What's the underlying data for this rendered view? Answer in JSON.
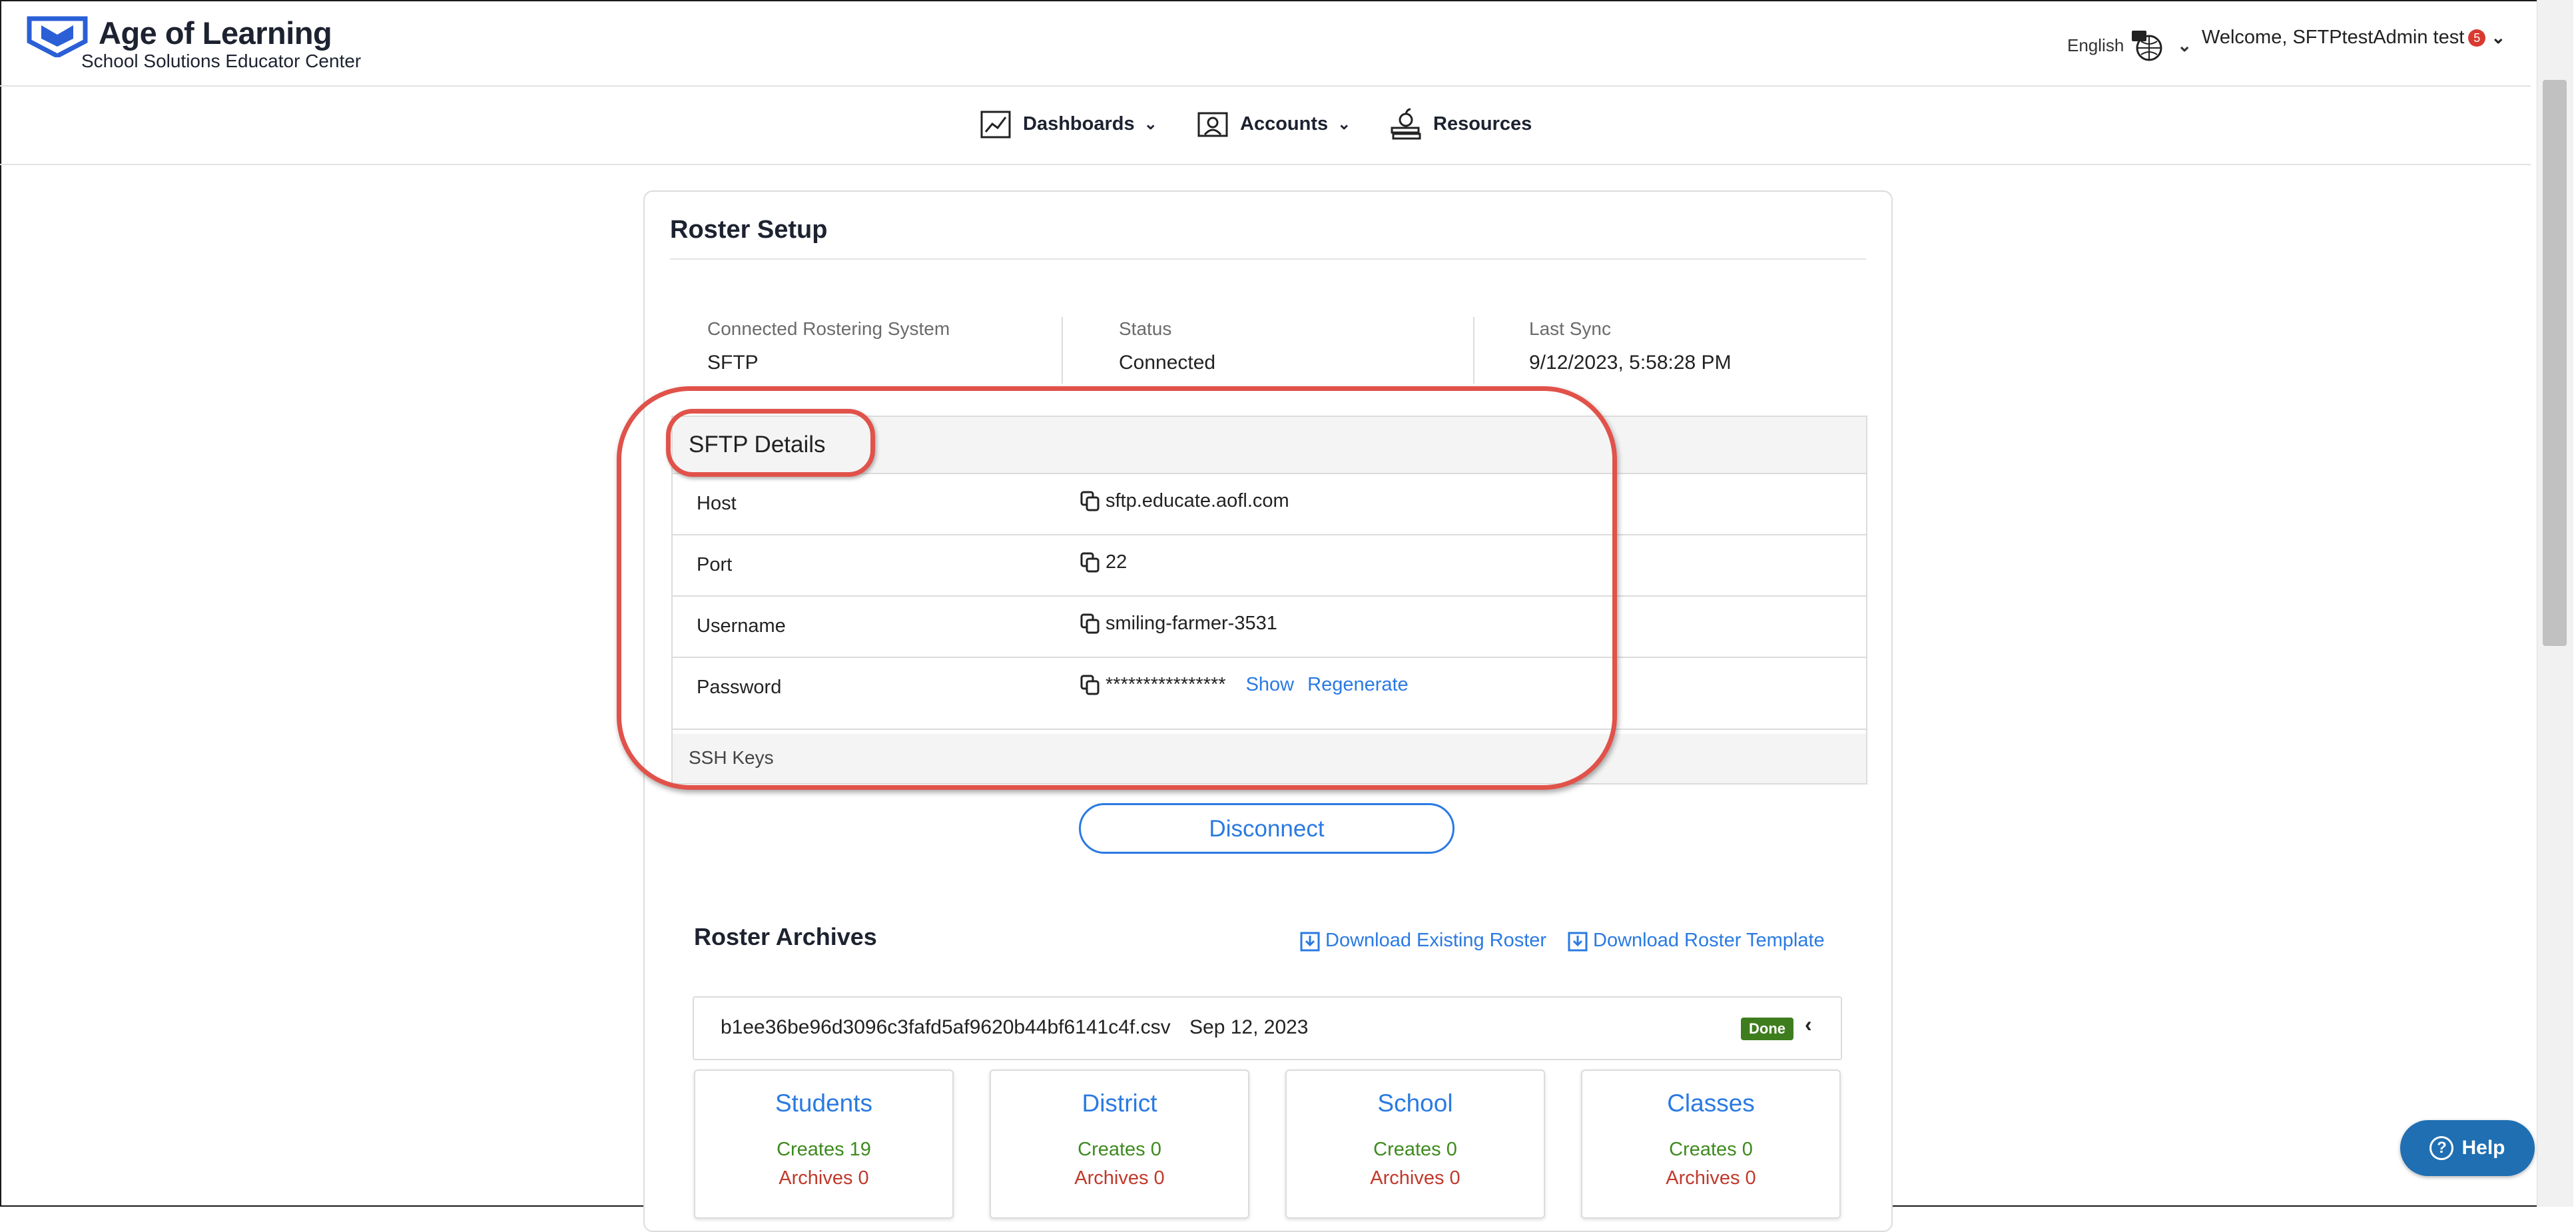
{
  "header": {
    "brand": "Age of Learning",
    "brand_sub": "School Solutions Educator Center",
    "language": "English",
    "welcome": "Welcome, SFTPtestAdmin test",
    "notification_count": "5"
  },
  "nav": {
    "dashboards": "Dashboards",
    "accounts": "Accounts",
    "resources": "Resources"
  },
  "roster": {
    "title": "Roster Setup",
    "system_label": "Connected Rostering System",
    "system_value": "SFTP",
    "status_label": "Status",
    "status_value": "Connected",
    "sync_label": "Last Sync",
    "sync_value": "9/12/2023, 5:58:28 PM"
  },
  "sftp": {
    "title": "SFTP Details",
    "host_label": "Host",
    "host_value": "sftp.educate.aofl.com",
    "port_label": "Port",
    "port_value": "22",
    "username_label": "Username",
    "username_value": "smiling-farmer-3531",
    "password_label": "Password",
    "password_value": "****************",
    "show_label": "Show",
    "regenerate_label": "Regenerate",
    "ssh_label": "SSH Keys"
  },
  "disconnect_label": "Disconnect",
  "archives": {
    "title": "Roster Archives",
    "download_existing": "Download Existing Roster",
    "download_template": "Download Roster Template",
    "file_name": "b1ee36be96d3096c3fafd5af9620b44bf6141c4f.csv",
    "file_date": "Sep 12, 2023",
    "file_status": "Done",
    "stats": [
      {
        "title": "Students",
        "creates": "Creates 19",
        "archives": "Archives 0"
      },
      {
        "title": "District",
        "creates": "Creates 0",
        "archives": "Archives 0"
      },
      {
        "title": "School",
        "creates": "Creates 0",
        "archives": "Archives 0"
      },
      {
        "title": "Classes",
        "creates": "Creates 0",
        "archives": "Archives 0"
      }
    ]
  },
  "help_label": "Help",
  "colors": {
    "accent": "#2a7ae2",
    "annotation": "#e0524a",
    "done_badge": "#3e7d1e",
    "help_button": "#1f6fb2"
  }
}
